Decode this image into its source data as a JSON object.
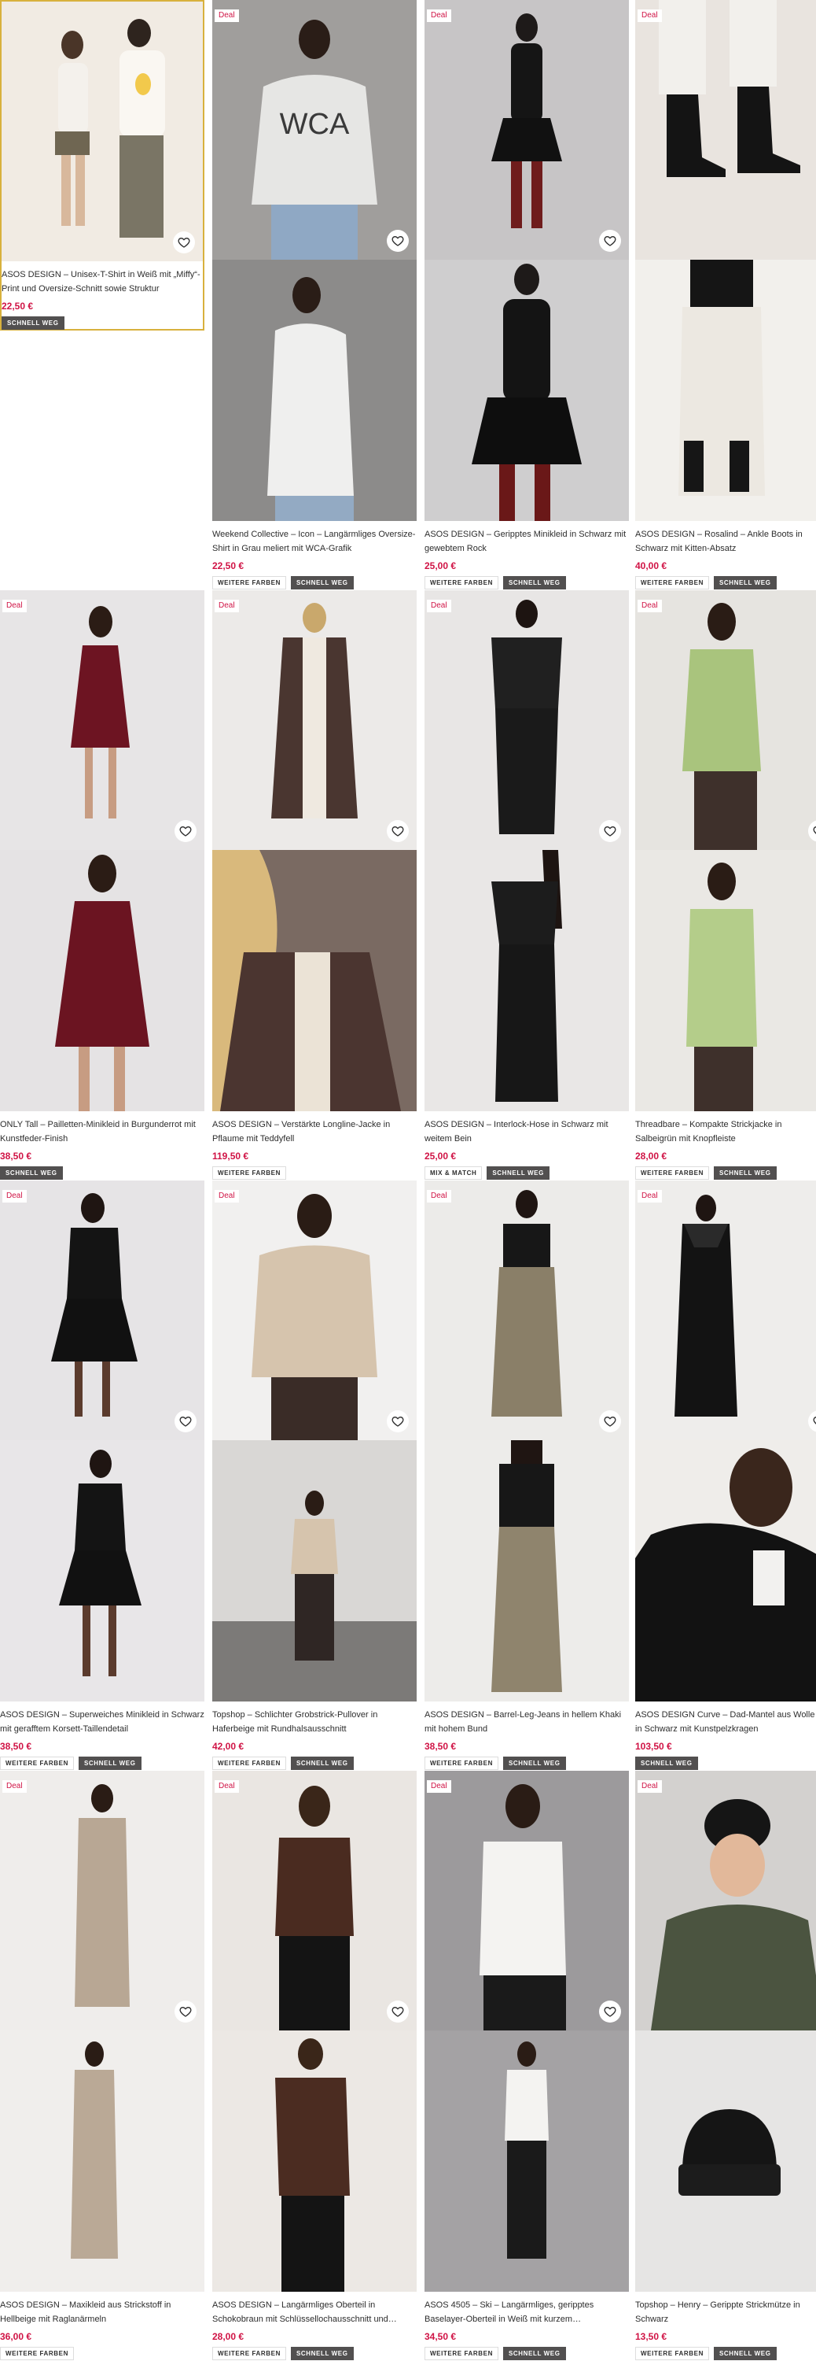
{
  "deal_label": "Deal",
  "more_colors": "WEITERE FARBEN",
  "selling_fast": "SCHNELL WEG",
  "mix_match": "MIX & MATCH",
  "colors": {
    "price": "#d01345",
    "deal": "#d01345",
    "highlight": "#d8b13d",
    "badge_dark": "#525050"
  },
  "products": [
    {
      "title": "ASOS DESIGN – Unisex-T-Shirt in Weiß mit „Miffy“-Print und Oversize-Schnitt sowie Struktur",
      "price": "22,50 €",
      "deal": false
    },
    {
      "title": "Weekend Collective – Icon – Langärmliges Oversize-Shirt in Grau meliert mit WCA-Grafik",
      "price": "22,50 €",
      "deal": true
    },
    {
      "title": "ASOS DESIGN – Geripptes Minikleid in Schwarz mit gewebtem Rock",
      "price": "25,00 €",
      "deal": true
    },
    {
      "title": "ASOS DESIGN – Rosalind – Ankle Boots in Schwarz mit Kitten-Absatz",
      "price": "40,00 €",
      "deal": true
    },
    {
      "title": "ONLY Tall – Pailletten-Minikleid in Burgunderrot mit Kunstfeder-Finish",
      "price": "38,50 €",
      "deal": true
    },
    {
      "title": "ASOS DESIGN – Verstärkte Longline-Jacke in Pflaume mit Teddyfell",
      "price": "119,50 €",
      "deal": true
    },
    {
      "title": "ASOS DESIGN – Interlock-Hose in Schwarz mit weitem Bein",
      "price": "25,00 €",
      "deal": true
    },
    {
      "title": "Threadbare – Kompakte Strickjacke in Salbeigrün mit Knopfleiste",
      "price": "28,00 €",
      "deal": true
    },
    {
      "title": "ASOS DESIGN – Superweiches Minikleid in Schwarz mit gerafftem Korsett-Taillendetail",
      "price": "38,50 €",
      "deal": true
    },
    {
      "title": "Topshop – Schlichter Grobstrick-Pullover in Haferbeige mit Rundhalsausschnitt",
      "price": "42,00 €",
      "deal": true
    },
    {
      "title": "ASOS DESIGN – Barrel-Leg-Jeans in hellem Khaki mit hohem Bund",
      "price": "38,50 €",
      "deal": true
    },
    {
      "title": "ASOS DESIGN Curve – Dad-Mantel aus Wolle in Schwarz mit Kunstpelzkragen",
      "price": "103,50 €",
      "deal": true
    },
    {
      "title": "ASOS DESIGN – Maxikleid aus Strickstoff in Hellbeige mit Raglanärmeln",
      "price": "36,00 €",
      "deal": true
    },
    {
      "title": "ASOS DESIGN – Langärmliges Oberteil in Schokobraun mit Schlüssellochausschnitt und…",
      "price": "28,00 €",
      "deal": true
    },
    {
      "title": "ASOS 4505 – Ski – Langärmliges, geripptes Baselayer-Oberteil in Weiß mit kurzem…",
      "price": "34,50 €",
      "deal": true
    },
    {
      "title": "Topshop – Henry – Gerippte Strickmütze in Schwarz",
      "price": "13,50 €",
      "deal": true
    }
  ]
}
